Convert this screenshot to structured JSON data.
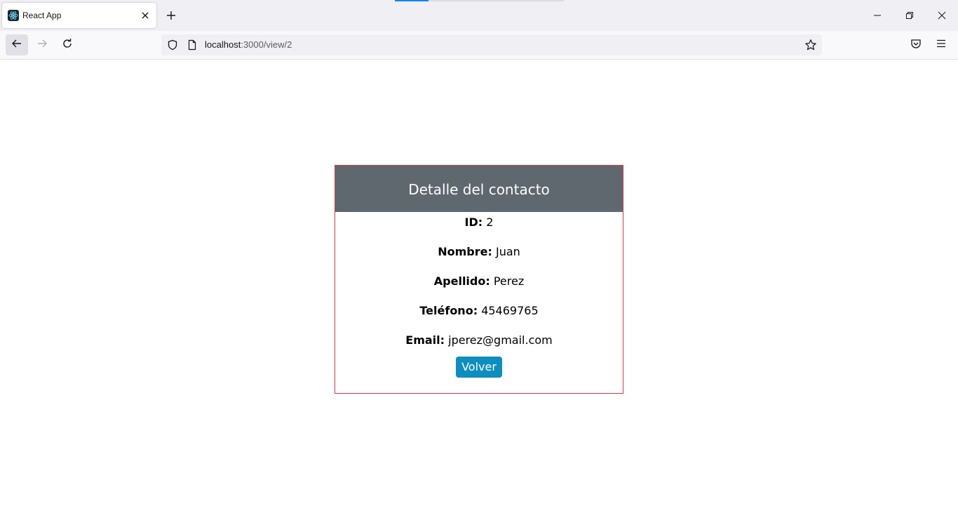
{
  "browser": {
    "tab": {
      "title": "React App",
      "favicon": "react-logo-icon"
    },
    "url": {
      "host": "localhost",
      "path": ":3000/view/2"
    },
    "icons": {
      "close_tab": "close-icon",
      "new_tab": "plus-icon",
      "minimize": "minimize-icon",
      "restore": "restore-icon",
      "close_window": "close-icon",
      "back": "arrow-left-icon",
      "forward": "arrow-right-icon",
      "reload": "reload-icon",
      "shield": "shield-icon",
      "page": "page-icon",
      "bookmark": "star-icon",
      "pocket": "pocket-icon",
      "menu": "hamburger-menu-icon"
    },
    "colors": {
      "accent": "#0a84ff"
    }
  },
  "contact_card": {
    "title": "Detalle del contacto",
    "fields": [
      {
        "label": "ID:",
        "value": "2"
      },
      {
        "label": "Nombre:",
        "value": "Juan"
      },
      {
        "label": "Apellido:",
        "value": "Perez"
      },
      {
        "label": "Teléfono:",
        "value": "45469765"
      },
      {
        "label": "Email:",
        "value": "jperez@gmail.com"
      }
    ],
    "button_label": "Volver",
    "colors": {
      "header_bg": "#5f676f",
      "border": "#dc3545",
      "button_bg": "#0d8ebf"
    }
  }
}
